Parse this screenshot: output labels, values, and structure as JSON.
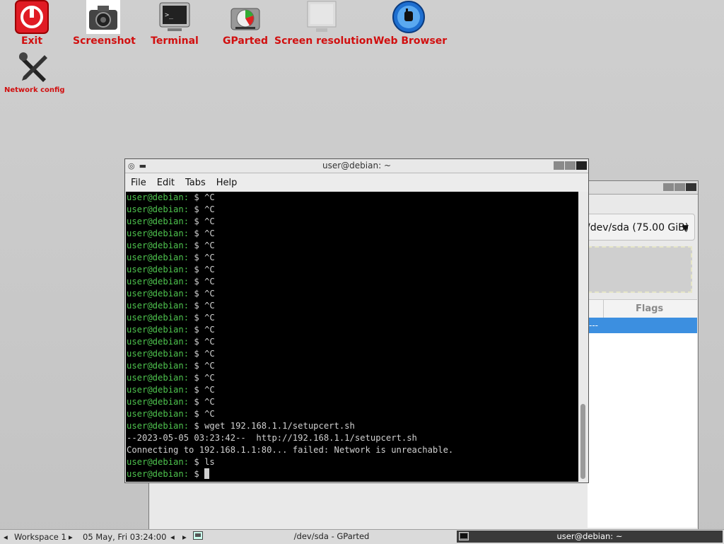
{
  "desktop": {
    "icons": [
      {
        "label": "Exit",
        "icon": "power-icon"
      },
      {
        "label": "Screenshot",
        "icon": "camera-icon"
      },
      {
        "label": "Terminal",
        "icon": "terminal-icon"
      },
      {
        "label": "GParted",
        "icon": "disk-icon"
      },
      {
        "label": "Screen resolution",
        "icon": "monitor-icon"
      },
      {
        "label": "Web Browser",
        "icon": "globe-icon"
      },
      {
        "label": "Network config",
        "icon": "tools-icon"
      }
    ]
  },
  "gparted": {
    "device": "/dev/sda (75.00 GiB)",
    "column_flags": "Flags",
    "row_partial": "---"
  },
  "terminal": {
    "title": "user@debian: ~",
    "menu": [
      "File",
      "Edit",
      "Tabs",
      "Help"
    ],
    "prompt": "user@debian:",
    "lines": [
      {
        "prompt": true,
        "text": " $ ^C"
      },
      {
        "prompt": true,
        "text": " $ ^C"
      },
      {
        "prompt": true,
        "text": " $ ^C"
      },
      {
        "prompt": true,
        "text": " $ ^C"
      },
      {
        "prompt": true,
        "text": " $ ^C"
      },
      {
        "prompt": true,
        "text": " $ ^C"
      },
      {
        "prompt": true,
        "text": " $ ^C"
      },
      {
        "prompt": true,
        "text": " $ ^C"
      },
      {
        "prompt": true,
        "text": " $ ^C"
      },
      {
        "prompt": true,
        "text": " $ ^C"
      },
      {
        "prompt": true,
        "text": " $ ^C"
      },
      {
        "prompt": true,
        "text": " $ ^C"
      },
      {
        "prompt": true,
        "text": " $ ^C"
      },
      {
        "prompt": true,
        "text": " $ ^C"
      },
      {
        "prompt": true,
        "text": " $ ^C"
      },
      {
        "prompt": true,
        "text": " $ ^C"
      },
      {
        "prompt": true,
        "text": " $ ^C"
      },
      {
        "prompt": true,
        "text": " $ ^C"
      },
      {
        "prompt": true,
        "text": " $ ^C"
      },
      {
        "prompt": true,
        "text": " $ wget 192.168.1.1/setupcert.sh"
      },
      {
        "prompt": false,
        "text": "--2023-05-05 03:23:42--  http://192.168.1.1/setupcert.sh"
      },
      {
        "prompt": false,
        "text": "Connecting to 192.168.1.1:80... failed: Network is unreachable."
      },
      {
        "prompt": true,
        "text": " $ ls"
      },
      {
        "prompt": true,
        "text": " $ ",
        "cursor": true
      }
    ]
  },
  "taskbar": {
    "workspace": "Workspace 1",
    "clock": "05 May, Fri 03:24:00",
    "task_gparted": "/dev/sda - GParted",
    "task_terminal": "user@debian: ~"
  }
}
